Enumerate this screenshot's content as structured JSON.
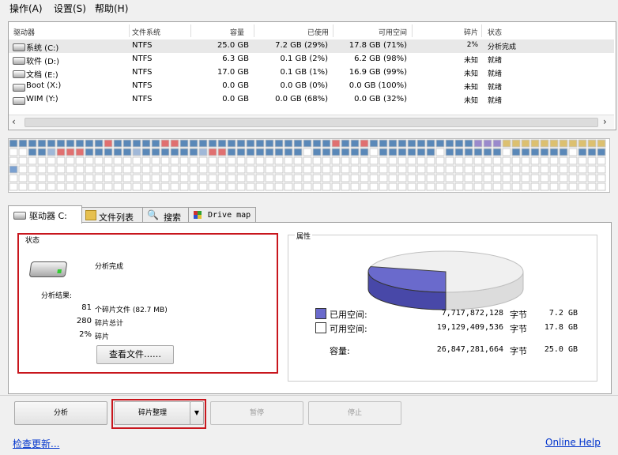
{
  "menu": [
    "操作(A)",
    "设置(S)",
    "帮助(H)"
  ],
  "drive_list": {
    "columns": [
      "驱动器",
      "文件系统",
      "容量",
      "已使用",
      "可用空间",
      "碎片",
      "状态"
    ],
    "rows": [
      {
        "name": "系统 (C:)",
        "fs": "NTFS",
        "capacity": "25.0 GB",
        "used": "7.2 GB (29%)",
        "free": "17.8 GB (71%)",
        "frag": "2%",
        "status": "分析完成"
      },
      {
        "name": "软件 (D:)",
        "fs": "NTFS",
        "capacity": "6.3 GB",
        "used": "0.1 GB (2%)",
        "free": "6.2 GB (98%)",
        "frag": "未知",
        "status": "就绪"
      },
      {
        "name": "文档 (E:)",
        "fs": "NTFS",
        "capacity": "17.0 GB",
        "used": "0.1 GB (1%)",
        "free": "16.9 GB (99%)",
        "frag": "未知",
        "status": "就绪"
      },
      {
        "name": "Boot (X:)",
        "fs": "NTFS",
        "capacity": "0.0 GB",
        "used": "0.0 GB (0%)",
        "free": "0.0 GB (100%)",
        "frag": "未知",
        "status": "就绪"
      },
      {
        "name": "WIM (Y:)",
        "fs": "NTFS",
        "capacity": "0.0 GB",
        "used": "0.0 GB (68%)",
        "free": "0.0 GB (32%)",
        "frag": "未知",
        "status": "就绪"
      }
    ],
    "scroll_left": "‹",
    "scroll_right": "›"
  },
  "tabs": [
    "驱动器 C:",
    "文件列表",
    "搜索",
    "Drive map"
  ],
  "status_panel": {
    "title": "状态",
    "status": "分析完成",
    "result_label": "分析结果:",
    "stats": [
      {
        "value": "81",
        "label": "个碎片文件 (82.7 MB)"
      },
      {
        "value": "280",
        "label": "碎片总计"
      },
      {
        "value": "2%",
        "label": "碎片"
      }
    ],
    "view_files_button": "查看文件……"
  },
  "properties_panel": {
    "title": "属性",
    "used_label": "已用空间:",
    "used_bytes": "7,717,872,128",
    "used_unit": "字节",
    "used_gb": "7.2 GB",
    "free_label": "可用空间:",
    "free_bytes": "19,129,409,536",
    "free_unit": "字节",
    "free_gb": "17.8 GB",
    "capacity_label": "容量:",
    "capacity_bytes": "26,847,281,664",
    "capacity_unit": "字节",
    "capacity_gb": "25.0 GB",
    "used_fraction": 0.29,
    "used_color": "#6a6acc",
    "free_color": "#f0f0f0"
  },
  "buttons": {
    "analyze": "分析",
    "defrag": "碎片整理",
    "pause": "暂停",
    "stop": "停止"
  },
  "footer": {
    "check_updates": "检查更新...",
    "online_help": "Online Help"
  },
  "colors": {
    "block_used": "#5a88b8",
    "block_fragmented": "#e07070",
    "block_mft": "#dcc070",
    "block_system": "#9a8acc",
    "block_free": "#ffffff",
    "highlight": "#c8161d"
  }
}
